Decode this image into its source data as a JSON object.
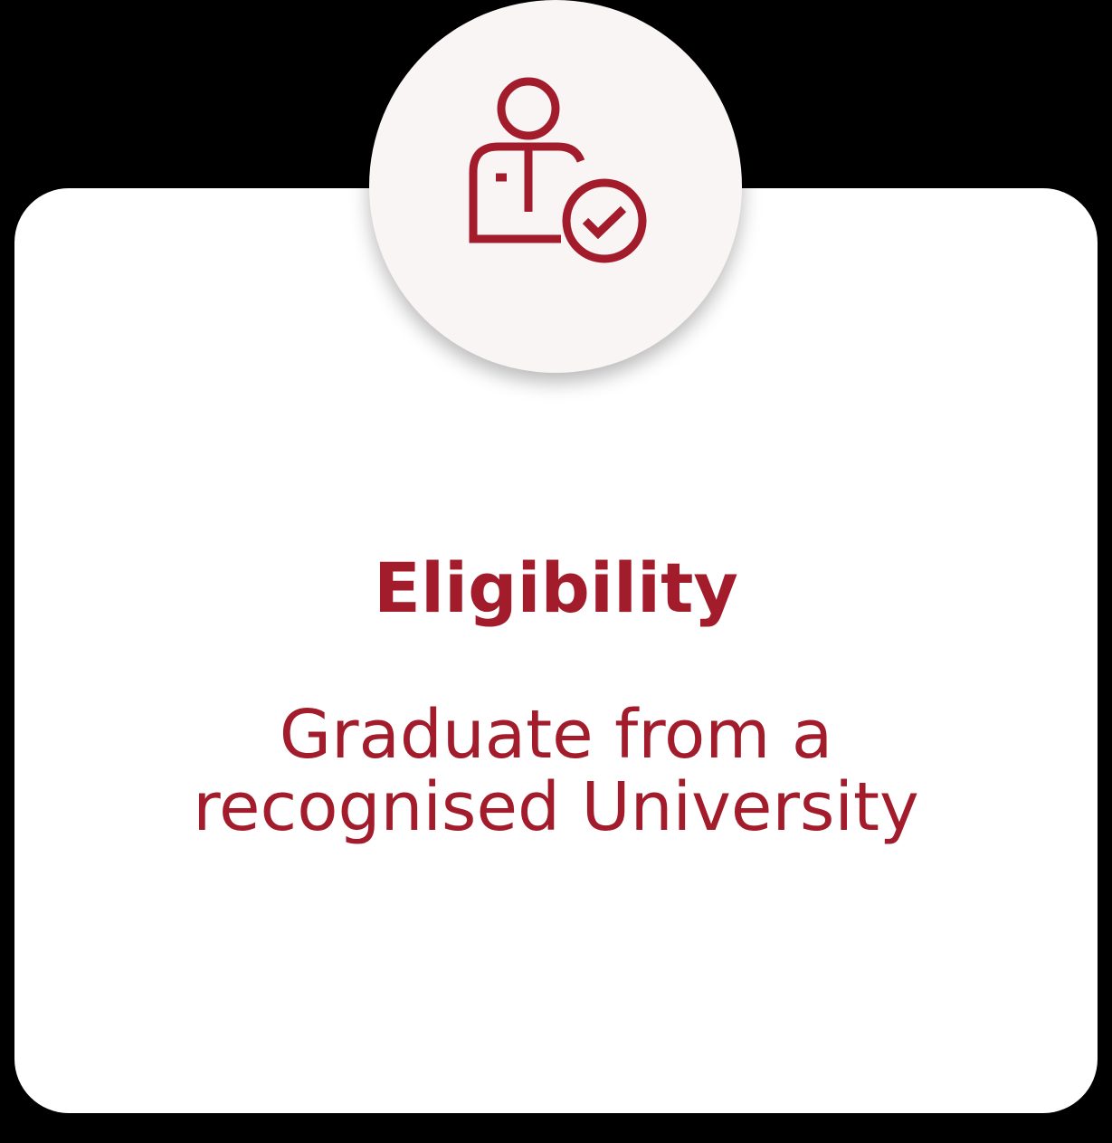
{
  "card": {
    "title": "Eligibility",
    "description_lines": [
      "Graduate from a",
      "recognised University"
    ]
  },
  "icon": {
    "name": "user-check-icon"
  },
  "colors": {
    "accent": "#a21c2b",
    "badge_bg": "#f9f5f5",
    "card_bg": "#ffffff",
    "page_bg": "#000000"
  }
}
